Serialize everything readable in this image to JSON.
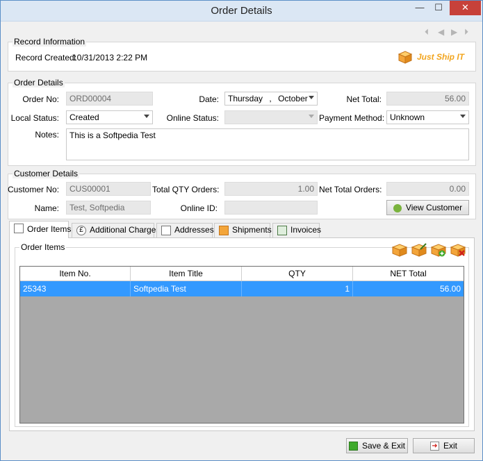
{
  "window": {
    "title": "Order Details",
    "minimize": "—",
    "maximize": "☐",
    "close": "✕"
  },
  "record": {
    "section_title": "Record Information",
    "created_label": "Record Created:",
    "created_value": "10/31/2013 2:22 PM",
    "logo_text": "Just Ship IT"
  },
  "order": {
    "section_title": "Order Details",
    "order_no_label": "Order No:",
    "order_no_value": "ORD00004",
    "date_label": "Date:",
    "date_day": "Thursday",
    "date_sep": ",",
    "date_month": "October",
    "net_total_label": "Net Total:",
    "net_total_value": "56.00",
    "local_status_label": "Local Status:",
    "local_status_value": "Created",
    "online_status_label": "Online Status:",
    "online_status_value": "",
    "payment_method_label": "Payment Method:",
    "payment_method_value": "Unknown",
    "notes_label": "Notes:",
    "notes_value": "This is a Softpedia Test"
  },
  "customer": {
    "section_title": "Customer Details",
    "customer_no_label": "Customer No:",
    "customer_no_value": "CUS00001",
    "total_qty_label": "Total QTY Orders:",
    "total_qty_value": "1.00",
    "net_total_orders_label": "Net Total Orders:",
    "net_total_orders_value": "0.00",
    "name_label": "Name:",
    "name_value": "Test, Softpedia",
    "online_id_label": "Online ID:",
    "online_id_value": "",
    "view_customer_label": "View Customer"
  },
  "tabs": [
    {
      "label": "Order Items",
      "active": true
    },
    {
      "label": "Additional Charges",
      "active": false
    },
    {
      "label": "Addresses",
      "active": false
    },
    {
      "label": "Shipments",
      "active": false
    },
    {
      "label": "Invoices",
      "active": false
    }
  ],
  "order_items": {
    "group_title": "Order Items",
    "columns": [
      "Item No.",
      "Item Title",
      "QTY",
      "NET Total"
    ],
    "rows": [
      {
        "item_no": "25343",
        "title": "Softpedia Test",
        "qty": "1",
        "net_total": "56.00"
      }
    ],
    "toolbar_icons": [
      "box-icon",
      "box-edit-icon",
      "box-add-icon",
      "box-delete-icon"
    ]
  },
  "footer": {
    "save_exit_label": "Save & Exit",
    "exit_label": "Exit"
  },
  "colors": {
    "selection": "#3399ff",
    "grid_empty": "#a9a9a9",
    "close_button": "#c7413a"
  }
}
